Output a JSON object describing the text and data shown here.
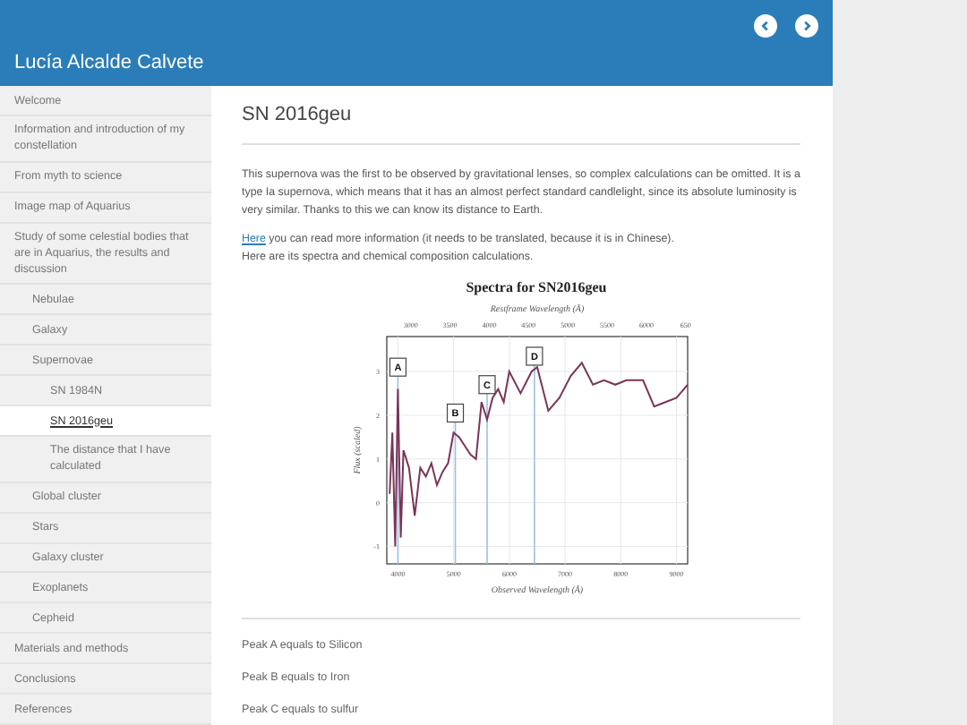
{
  "header": {
    "title": "Lucía Alcalde Calvete"
  },
  "sidebar": {
    "items": [
      {
        "label": "Welcome",
        "selected": false
      },
      {
        "label": "Information and introduction of my constellation",
        "selected": false
      },
      {
        "label": "From myth to science",
        "selected": false
      },
      {
        "label": "Image map of Aquarius",
        "selected": false
      },
      {
        "label": "Study of some celestial bodies that are in Aquarius, the results and discussion",
        "selected": false,
        "children": [
          {
            "label": "Nebulae",
            "selected": false
          },
          {
            "label": "Galaxy",
            "selected": false
          },
          {
            "label": "Supernovae",
            "selected": false,
            "children": [
              {
                "label": "SN 1984N",
                "selected": false
              },
              {
                "label": "SN 2016geu",
                "selected": true
              },
              {
                "label": "The distance that I have calculated",
                "selected": false
              }
            ]
          },
          {
            "label": "Global cluster",
            "selected": false
          },
          {
            "label": "Stars",
            "selected": false
          },
          {
            "label": "Galaxy cluster",
            "selected": false
          },
          {
            "label": "Exoplanets",
            "selected": false
          },
          {
            "label": "Cepheid",
            "selected": false
          }
        ]
      },
      {
        "label": "Materials and methods",
        "selected": false
      },
      {
        "label": "Conclusions",
        "selected": false
      },
      {
        "label": "References",
        "selected": false
      }
    ]
  },
  "main": {
    "heading": "SN 2016geu",
    "paragraph": "This supernova was the first to be observed by gravitational lenses, so complex calculations can be omitted. It is a type Ia supernova, which means that it has an almost perfect standard candlelight, since its absolute luminosity is very similar. Thanks to this we can know its distance to Earth.",
    "link_sentence": {
      "link": "Here",
      "text": " you can read more information (it needs to be translated, because it is in Chinese)."
    },
    "intro": "Here are its spectra and chemical composition calculations.",
    "chart_data": {
      "type": "line",
      "title": "Spectra for SN2016geu",
      "xlabel": "Observed Wavelength (Å)",
      "ylabel": "Flux (scaled)",
      "x": [
        3850,
        3900,
        3950,
        4000,
        4050,
        4100,
        4200,
        4300,
        4400,
        4500,
        4600,
        4700,
        4800,
        4900,
        5000,
        5100,
        5200,
        5300,
        5400,
        5500,
        5600,
        5700,
        5800,
        5900,
        6000,
        6200,
        6400,
        6500,
        6700,
        6900,
        7100,
        7300,
        7500,
        7700,
        7900,
        8100,
        8400,
        8600,
        8800,
        9000,
        9200
      ],
      "series": [
        {
          "color": "#7a3558",
          "values": [
            0.2,
            1.6,
            -1.0,
            2.6,
            -0.8,
            1.2,
            0.8,
            -0.3,
            0.8,
            0.6,
            0.9,
            0.4,
            0.7,
            0.9,
            1.6,
            1.5,
            1.3,
            1.1,
            1.0,
            2.3,
            1.9,
            2.4,
            2.6,
            2.3,
            3.0,
            2.5,
            3.0,
            3.1,
            2.1,
            2.4,
            2.9,
            3.2,
            2.7,
            2.8,
            2.7,
            2.8,
            2.8,
            2.2,
            2.3,
            2.4,
            2.7
          ]
        }
      ],
      "xlim": [
        3800,
        9200
      ],
      "ylim": [
        -1.4,
        3.8
      ],
      "xticks": [
        4000,
        5000,
        6000,
        7000,
        8000,
        9000
      ],
      "yticks": [
        -1,
        0,
        1,
        2,
        3
      ],
      "grid": true,
      "ref_lines": [
        {
          "axis": "x",
          "value": 4000,
          "color": "#9dc0e0"
        },
        {
          "axis": "x",
          "value": 5030,
          "color": "#9dc0e0"
        },
        {
          "axis": "x",
          "value": 5600,
          "color": "#9dc0e0"
        },
        {
          "axis": "x",
          "value": 6450,
          "color": "#9dc0e0"
        }
      ],
      "annotations": [
        {
          "text": "A",
          "x": 4000,
          "y": 3.1
        },
        {
          "text": "B",
          "x": 5030,
          "y": 2.05
        },
        {
          "text": "C",
          "x": 5600,
          "y": 2.7
        },
        {
          "text": "D",
          "x": 6450,
          "y": 3.35
        }
      ]
    },
    "chart_top_axis": {
      "label": "Restframe Wavelength (Å)",
      "ticks": [
        "3000",
        "3500",
        "4000",
        "4500",
        "5000",
        "5500",
        "6000",
        "650"
      ]
    },
    "peaks": [
      "Peak A equals to Silicon",
      "Peak B equals to Iron",
      "Peak C equals to sulfur"
    ]
  }
}
